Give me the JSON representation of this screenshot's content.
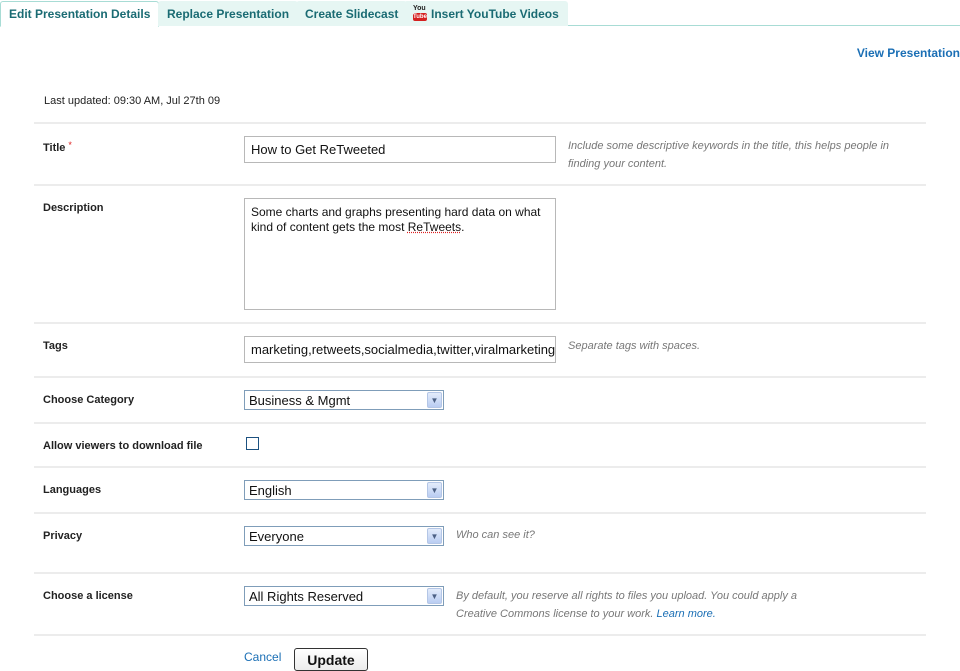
{
  "tabs": [
    {
      "label": "Edit Presentation Details",
      "active": true
    },
    {
      "label": "Replace Presentation",
      "active": false
    },
    {
      "label": "Create Slidecast",
      "active": false
    },
    {
      "label": "Insert YouTube Videos",
      "active": false,
      "icon": "youtube-icon"
    }
  ],
  "youtube_icon": {
    "top": "You",
    "bottom": "Tube"
  },
  "view_presentation": "View Presentation",
  "last_updated": "Last updated: 09:30 AM, Jul 27th 09",
  "form": {
    "title": {
      "label": "Title",
      "required_mark": "*",
      "value": "How to Get ReTweeted",
      "hint": "Include some descriptive keywords in the title, this helps people in finding your content."
    },
    "description": {
      "label": "Description",
      "value_part1": "Some charts and graphs presenting hard data on what kind of content gets the most ",
      "value_misspelled": "ReTweets",
      "value_end": "."
    },
    "tags": {
      "label": "Tags",
      "value": "marketing,retweets,socialmedia,twitter,viralmarketing",
      "hint": "Separate tags with spaces."
    },
    "category": {
      "label": "Choose Category",
      "value": "Business & Mgmt"
    },
    "download": {
      "label": "Allow viewers to download file",
      "checked": false
    },
    "languages": {
      "label": "Languages",
      "value": "English"
    },
    "privacy": {
      "label": "Privacy",
      "value": "Everyone",
      "hint": "Who can see it?"
    },
    "license": {
      "label": "Choose a license",
      "value": "All Rights Reserved",
      "hint": "By default, you reserve all rights to files you upload. You could apply a Creative Commons license to your work.",
      "learn_more": "Learn more."
    }
  },
  "actions": {
    "cancel": "Cancel",
    "update": "Update"
  },
  "select_arrow": "▼"
}
